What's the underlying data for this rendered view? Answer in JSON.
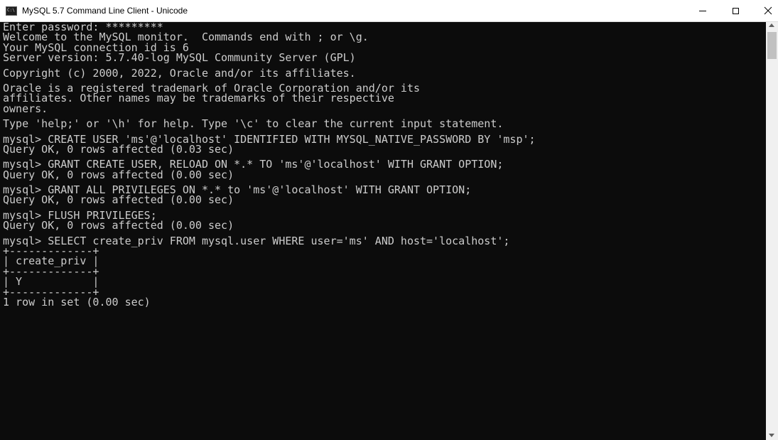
{
  "window": {
    "title": "MySQL 5.7 Command Line Client - Unicode",
    "icon_name": "console-app-icon",
    "icon_text": "C:\\",
    "controls": {
      "minimize": "minimize-icon",
      "maximize": "maximize-icon",
      "close": "close-icon"
    }
  },
  "colors": {
    "console_background": "#0c0c0c",
    "console_text": "#cccccc",
    "titlebar_background": "#ffffff"
  },
  "console": {
    "blocks": [
      {
        "lines": [
          "Enter password: *********",
          "Welcome to the MySQL monitor.  Commands end with ; or \\g.",
          "Your MySQL connection id is 6",
          "Server version: 5.7.40-log MySQL Community Server (GPL)"
        ]
      },
      {
        "lines": [
          "Copyright (c) 2000, 2022, Oracle and/or its affiliates."
        ]
      },
      {
        "lines": [
          "Oracle is a registered trademark of Oracle Corporation and/or its",
          "affiliates. Other names may be trademarks of their respective",
          "owners."
        ]
      },
      {
        "lines": [
          "Type 'help;' or '\\h' for help. Type '\\c' to clear the current input statement."
        ]
      },
      {
        "lines": [
          "mysql> CREATE USER 'ms'@'localhost' IDENTIFIED WITH MYSQL_NATIVE_PASSWORD BY 'msp';",
          "Query OK, 0 rows affected (0.03 sec)"
        ]
      },
      {
        "lines": [
          "mysql> GRANT CREATE USER, RELOAD ON *.* TO 'ms'@'localhost' WITH GRANT OPTION;",
          "Query OK, 0 rows affected (0.00 sec)"
        ]
      },
      {
        "lines": [
          "mysql> GRANT ALL PRIVILEGES ON *.* to 'ms'@'localhost' WITH GRANT OPTION;",
          "Query OK, 0 rows affected (0.00 sec)"
        ]
      },
      {
        "lines": [
          "mysql> FLUSH PRIVILEGES;",
          "Query OK, 0 rows affected (0.00 sec)"
        ]
      },
      {
        "lines": [
          "mysql> SELECT create_priv FROM mysql.user WHERE user='ms' AND host='localhost';",
          "+-------------+",
          "| create_priv |",
          "+-------------+",
          "| Y           |",
          "+-------------+",
          "1 row in set (0.00 sec)"
        ]
      }
    ]
  }
}
